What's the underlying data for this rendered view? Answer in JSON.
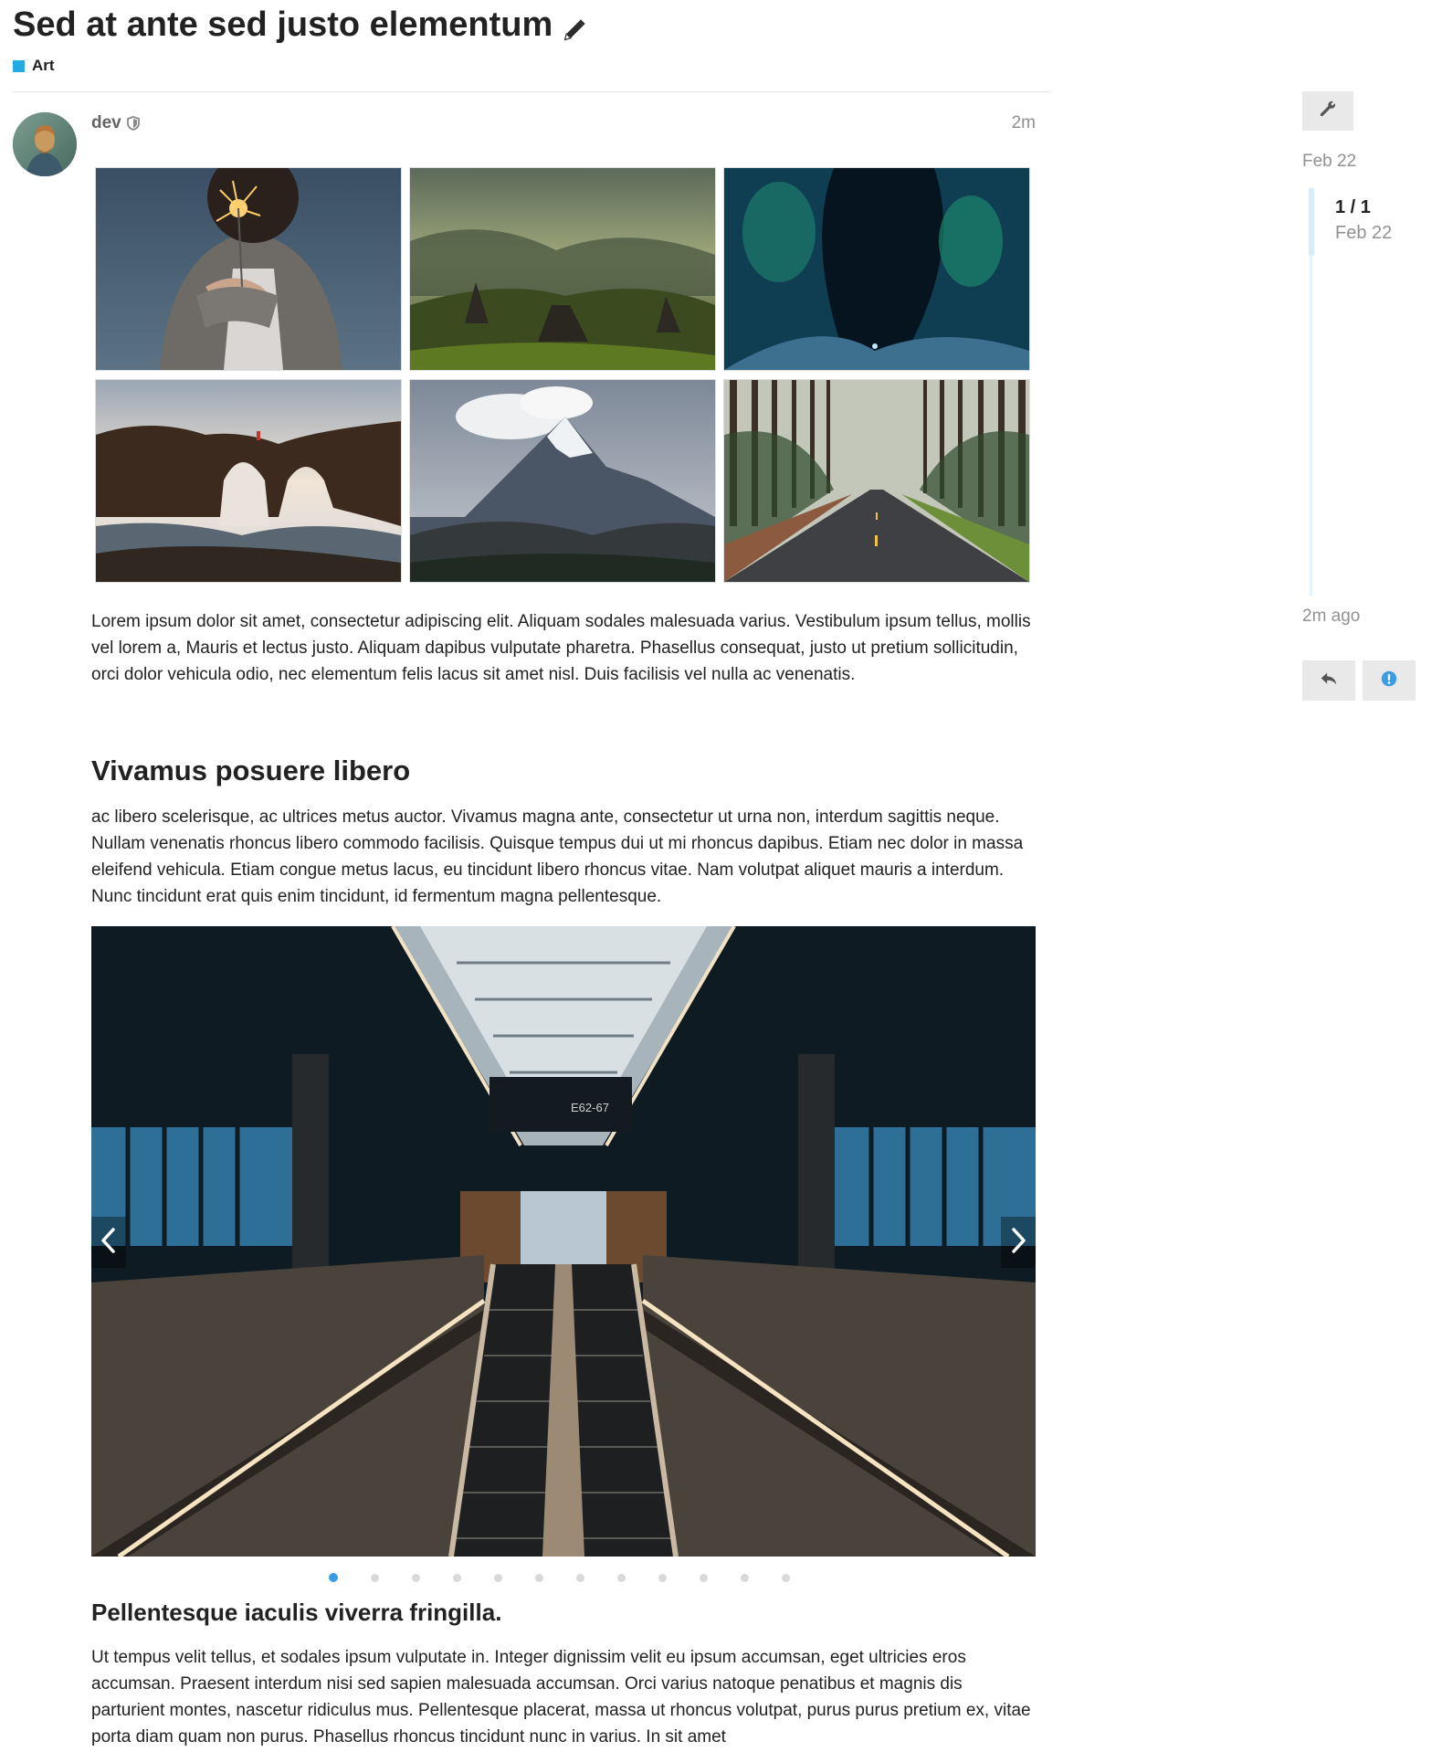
{
  "topic": {
    "title": "Sed at ante sed justo elementum",
    "category": "Art",
    "category_color": "#25aae1"
  },
  "post": {
    "username": "dev",
    "age": "2m",
    "paragraphs": [
      "Lorem ipsum dolor sit amet, consectetur adipiscing elit. Aliquam sodales malesuada varius. Vestibulum ipsum tellus, mollis vel lorem a, Mauris et lectus justo. Aliquam dapibus vulputate pharetra. Phasellus consequat, justo ut pretium sollicitudin, orci dolor vehicula odio, nec elementum felis lacus sit amet nisl. Duis facilisis vel nulla ac venenatis.",
      "ac libero scelerisque, ac ultrices metus auctor. Vivamus magna ante, consectetur ut urna non, interdum sagittis neque. Nullam venenatis rhoncus libero commodo facilisis. Quisque tempus dui ut mi rhoncus dapibus. Etiam nec dolor in massa eleifend vehicula. Etiam congue metus lacus, eu tincidunt libero rhoncus vitae. Nam volutpat aliquet mauris a interdum. Nunc tincidunt erat quis enim tincidunt, id fermentum magna pellentesque.",
      "Ut tempus velit tellus, et sodales ipsum vulputate in. Integer dignissim velit eu ipsum accumsan, eget ultricies eros accumsan. Praesent interdum nisi sed sapien malesuada accumsan. Orci varius natoque penatibus et magnis dis parturient montes, nascetur ridiculus mus. Pellentesque placerat, massa ut rhoncus volutpat, purus purus pretium ex, vitae porta diam quam non purus. Phasellus rhoncus tincidunt nunc in varius. In sit amet"
    ],
    "headings": [
      "Vivamus posuere libero",
      "Pellentesque iaculis viverra fringilla."
    ],
    "gallery": [
      "sparkler-photo",
      "mountain-valley-photo",
      "ice-cave-aurora-photo",
      "sea-arch-photo",
      "matterhorn-photo",
      "forest-road-photo"
    ],
    "carousel": {
      "current_image": "escalator-hall-photo",
      "sign_text": "E62-67",
      "slide_count": 12,
      "active_index": 1
    }
  },
  "timeline": {
    "start_date": "Feb 22",
    "position": "1 / 1",
    "position_date": "Feb 22",
    "end_label": "2m ago"
  },
  "icons": {
    "edit": "pencil-icon",
    "shield": "shield-icon",
    "wrench": "wrench-icon",
    "reply": "reply-icon",
    "notify": "exclamation-circle-icon",
    "prev": "chevron-left-icon",
    "next": "chevron-right-icon"
  },
  "colors": {
    "accent_blue": "#3a9de2",
    "notify_blue": "#3a9de2",
    "timeline_track": "#e3f2fc"
  }
}
